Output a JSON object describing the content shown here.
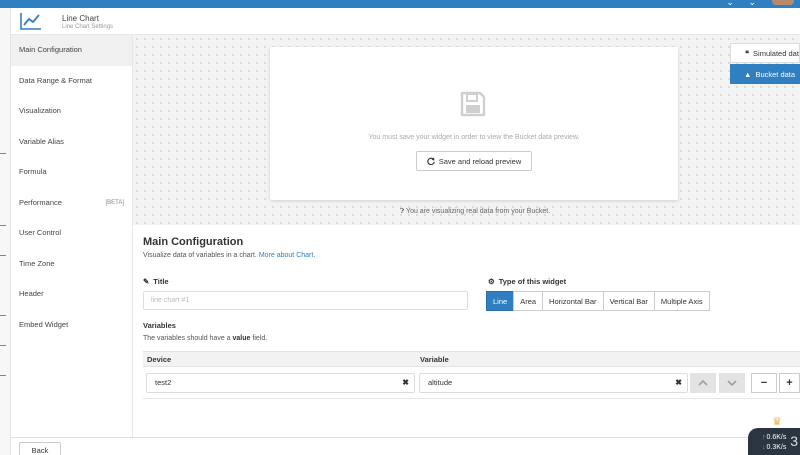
{
  "header": {
    "title": "Line Chart",
    "subtitle": "Line Chart Settings"
  },
  "sidebar": {
    "items": [
      {
        "label": "Main Configuration",
        "badge": ""
      },
      {
        "label": "Data Range & Format",
        "badge": ""
      },
      {
        "label": "Visualization",
        "badge": ""
      },
      {
        "label": "Variable Alias",
        "badge": ""
      },
      {
        "label": "Formula",
        "badge": ""
      },
      {
        "label": "Performance",
        "badge": "[BETA]"
      },
      {
        "label": "User Control",
        "badge": ""
      },
      {
        "label": "Time Zone",
        "badge": ""
      },
      {
        "label": "Header",
        "badge": ""
      },
      {
        "label": "Embed Widget",
        "badge": ""
      }
    ]
  },
  "preview": {
    "message": "You must save your widget in order to view the Bucket data preview.",
    "reload_label": "Save and reload preview",
    "real_data_note": "You are visualizing real data from your Bucket."
  },
  "data_tabs": {
    "simulated": "Simulated dat",
    "bucket": "Bucket data"
  },
  "main": {
    "title": "Main Configuration",
    "description": "Visualize data of variables in a chart.",
    "more_link": "More about Chart.",
    "title_label": "Title",
    "title_placeholder": "line chart #1",
    "type_label": "Type of this widget",
    "types": [
      "Line",
      "Area",
      "Horizontal Bar",
      "Vertical Bar",
      "Multiple Axis"
    ],
    "selected_type": "Line",
    "variables_label": "Variables",
    "variables_hint_pre": "The variables should have a",
    "variables_hint_bold": "value",
    "variables_hint_post": "field.",
    "col_device": "Device",
    "col_variable": "Variable",
    "row": {
      "device": "test2",
      "variable": "altitude"
    },
    "remove_symbol": "−",
    "add_symbol": "+"
  },
  "footer": {
    "back_label": "Back"
  },
  "network": {
    "up": "0.6K/s",
    "down": "0.3K/s",
    "count": "3"
  },
  "colors": {
    "accent": "#2f7fc1",
    "dark": "#2b3542"
  }
}
